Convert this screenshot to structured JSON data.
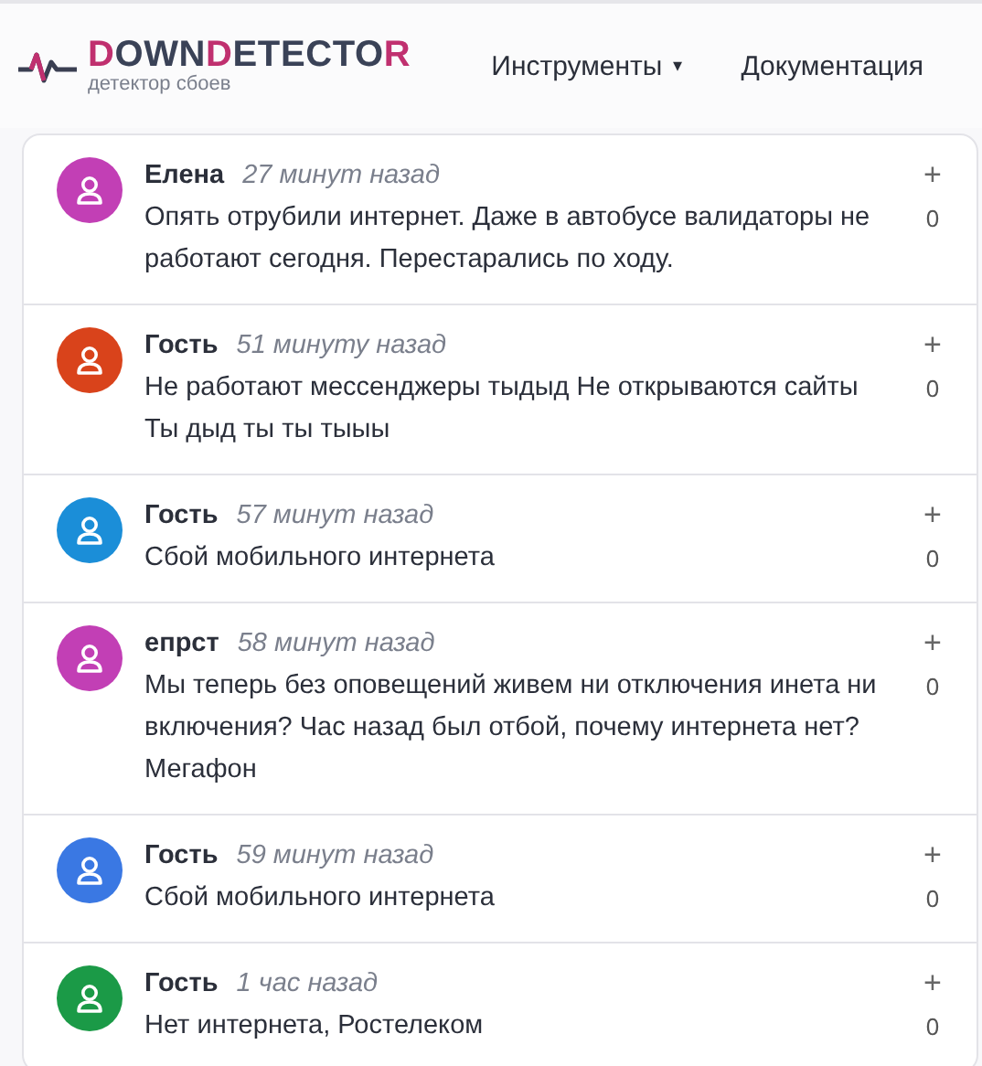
{
  "logo": {
    "parts": [
      {
        "text": "D",
        "accent": true
      },
      {
        "text": "OWN",
        "accent": false
      },
      {
        "text": "D",
        "accent": true
      },
      {
        "text": "ETECTO",
        "accent": false
      },
      {
        "text": "R",
        "accent": true
      }
    ],
    "tagline": "детектор сбоев"
  },
  "nav": [
    {
      "label": "Инструменты",
      "dropdown": true,
      "caret": "▾"
    },
    {
      "label": "Документация",
      "dropdown": false
    }
  ],
  "comments": [
    {
      "author": "Елена",
      "time": "27 минут назад",
      "text": "Опять отрубили интернет. Даже в автобусе валидаторы не работают сегодня. Перестарались по ходу.",
      "color": "#c23fb5",
      "plus": "+",
      "votes": "0"
    },
    {
      "author": "Гость",
      "time": "51 минуту назад",
      "text": "Не работают мессенджеры тыдыд Не открываются сайты Ты дыд ты ты тыыы",
      "color": "#d9431b",
      "plus": "+",
      "votes": "0"
    },
    {
      "author": "Гость",
      "time": "57 минут назад",
      "text": "Сбой мобильного интернета",
      "color": "#1b8ed8",
      "plus": "+",
      "votes": "0"
    },
    {
      "author": "епрст",
      "time": "58 минут назад",
      "text": "Мы теперь без оповещений живем ни отключения инета ни включения? Час назад был отбой, почему интернета нет? Мегафон",
      "color": "#c23fb5",
      "plus": "+",
      "votes": "0"
    },
    {
      "author": "Гость",
      "time": "59 минут назад",
      "text": "Сбой мобильного интернета",
      "color": "#3a78e3",
      "plus": "+",
      "votes": "0"
    },
    {
      "author": "Гость",
      "time": "1 час назад",
      "text": "Нет интернета, Ростелеком",
      "color": "#1b9a47",
      "plus": "+",
      "votes": "0"
    }
  ]
}
